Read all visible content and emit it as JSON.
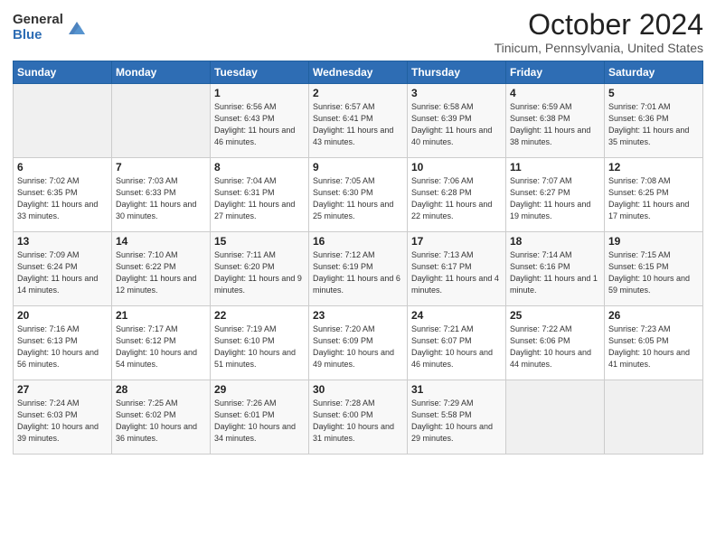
{
  "header": {
    "logo_general": "General",
    "logo_blue": "Blue",
    "month_title": "October 2024",
    "location": "Tinicum, Pennsylvania, United States"
  },
  "weekdays": [
    "Sunday",
    "Monday",
    "Tuesday",
    "Wednesday",
    "Thursday",
    "Friday",
    "Saturday"
  ],
  "weeks": [
    [
      {
        "day": "",
        "sunrise": "",
        "sunset": "",
        "daylight": ""
      },
      {
        "day": "",
        "sunrise": "",
        "sunset": "",
        "daylight": ""
      },
      {
        "day": "1",
        "sunrise": "Sunrise: 6:56 AM",
        "sunset": "Sunset: 6:43 PM",
        "daylight": "Daylight: 11 hours and 46 minutes."
      },
      {
        "day": "2",
        "sunrise": "Sunrise: 6:57 AM",
        "sunset": "Sunset: 6:41 PM",
        "daylight": "Daylight: 11 hours and 43 minutes."
      },
      {
        "day": "3",
        "sunrise": "Sunrise: 6:58 AM",
        "sunset": "Sunset: 6:39 PM",
        "daylight": "Daylight: 11 hours and 40 minutes."
      },
      {
        "day": "4",
        "sunrise": "Sunrise: 6:59 AM",
        "sunset": "Sunset: 6:38 PM",
        "daylight": "Daylight: 11 hours and 38 minutes."
      },
      {
        "day": "5",
        "sunrise": "Sunrise: 7:01 AM",
        "sunset": "Sunset: 6:36 PM",
        "daylight": "Daylight: 11 hours and 35 minutes."
      }
    ],
    [
      {
        "day": "6",
        "sunrise": "Sunrise: 7:02 AM",
        "sunset": "Sunset: 6:35 PM",
        "daylight": "Daylight: 11 hours and 33 minutes."
      },
      {
        "day": "7",
        "sunrise": "Sunrise: 7:03 AM",
        "sunset": "Sunset: 6:33 PM",
        "daylight": "Daylight: 11 hours and 30 minutes."
      },
      {
        "day": "8",
        "sunrise": "Sunrise: 7:04 AM",
        "sunset": "Sunset: 6:31 PM",
        "daylight": "Daylight: 11 hours and 27 minutes."
      },
      {
        "day": "9",
        "sunrise": "Sunrise: 7:05 AM",
        "sunset": "Sunset: 6:30 PM",
        "daylight": "Daylight: 11 hours and 25 minutes."
      },
      {
        "day": "10",
        "sunrise": "Sunrise: 7:06 AM",
        "sunset": "Sunset: 6:28 PM",
        "daylight": "Daylight: 11 hours and 22 minutes."
      },
      {
        "day": "11",
        "sunrise": "Sunrise: 7:07 AM",
        "sunset": "Sunset: 6:27 PM",
        "daylight": "Daylight: 11 hours and 19 minutes."
      },
      {
        "day": "12",
        "sunrise": "Sunrise: 7:08 AM",
        "sunset": "Sunset: 6:25 PM",
        "daylight": "Daylight: 11 hours and 17 minutes."
      }
    ],
    [
      {
        "day": "13",
        "sunrise": "Sunrise: 7:09 AM",
        "sunset": "Sunset: 6:24 PM",
        "daylight": "Daylight: 11 hours and 14 minutes."
      },
      {
        "day": "14",
        "sunrise": "Sunrise: 7:10 AM",
        "sunset": "Sunset: 6:22 PM",
        "daylight": "Daylight: 11 hours and 12 minutes."
      },
      {
        "day": "15",
        "sunrise": "Sunrise: 7:11 AM",
        "sunset": "Sunset: 6:20 PM",
        "daylight": "Daylight: 11 hours and 9 minutes."
      },
      {
        "day": "16",
        "sunrise": "Sunrise: 7:12 AM",
        "sunset": "Sunset: 6:19 PM",
        "daylight": "Daylight: 11 hours and 6 minutes."
      },
      {
        "day": "17",
        "sunrise": "Sunrise: 7:13 AM",
        "sunset": "Sunset: 6:17 PM",
        "daylight": "Daylight: 11 hours and 4 minutes."
      },
      {
        "day": "18",
        "sunrise": "Sunrise: 7:14 AM",
        "sunset": "Sunset: 6:16 PM",
        "daylight": "Daylight: 11 hours and 1 minute."
      },
      {
        "day": "19",
        "sunrise": "Sunrise: 7:15 AM",
        "sunset": "Sunset: 6:15 PM",
        "daylight": "Daylight: 10 hours and 59 minutes."
      }
    ],
    [
      {
        "day": "20",
        "sunrise": "Sunrise: 7:16 AM",
        "sunset": "Sunset: 6:13 PM",
        "daylight": "Daylight: 10 hours and 56 minutes."
      },
      {
        "day": "21",
        "sunrise": "Sunrise: 7:17 AM",
        "sunset": "Sunset: 6:12 PM",
        "daylight": "Daylight: 10 hours and 54 minutes."
      },
      {
        "day": "22",
        "sunrise": "Sunrise: 7:19 AM",
        "sunset": "Sunset: 6:10 PM",
        "daylight": "Daylight: 10 hours and 51 minutes."
      },
      {
        "day": "23",
        "sunrise": "Sunrise: 7:20 AM",
        "sunset": "Sunset: 6:09 PM",
        "daylight": "Daylight: 10 hours and 49 minutes."
      },
      {
        "day": "24",
        "sunrise": "Sunrise: 7:21 AM",
        "sunset": "Sunset: 6:07 PM",
        "daylight": "Daylight: 10 hours and 46 minutes."
      },
      {
        "day": "25",
        "sunrise": "Sunrise: 7:22 AM",
        "sunset": "Sunset: 6:06 PM",
        "daylight": "Daylight: 10 hours and 44 minutes."
      },
      {
        "day": "26",
        "sunrise": "Sunrise: 7:23 AM",
        "sunset": "Sunset: 6:05 PM",
        "daylight": "Daylight: 10 hours and 41 minutes."
      }
    ],
    [
      {
        "day": "27",
        "sunrise": "Sunrise: 7:24 AM",
        "sunset": "Sunset: 6:03 PM",
        "daylight": "Daylight: 10 hours and 39 minutes."
      },
      {
        "day": "28",
        "sunrise": "Sunrise: 7:25 AM",
        "sunset": "Sunset: 6:02 PM",
        "daylight": "Daylight: 10 hours and 36 minutes."
      },
      {
        "day": "29",
        "sunrise": "Sunrise: 7:26 AM",
        "sunset": "Sunset: 6:01 PM",
        "daylight": "Daylight: 10 hours and 34 minutes."
      },
      {
        "day": "30",
        "sunrise": "Sunrise: 7:28 AM",
        "sunset": "Sunset: 6:00 PM",
        "daylight": "Daylight: 10 hours and 31 minutes."
      },
      {
        "day": "31",
        "sunrise": "Sunrise: 7:29 AM",
        "sunset": "Sunset: 5:58 PM",
        "daylight": "Daylight: 10 hours and 29 minutes."
      },
      {
        "day": "",
        "sunrise": "",
        "sunset": "",
        "daylight": ""
      },
      {
        "day": "",
        "sunrise": "",
        "sunset": "",
        "daylight": ""
      }
    ]
  ]
}
